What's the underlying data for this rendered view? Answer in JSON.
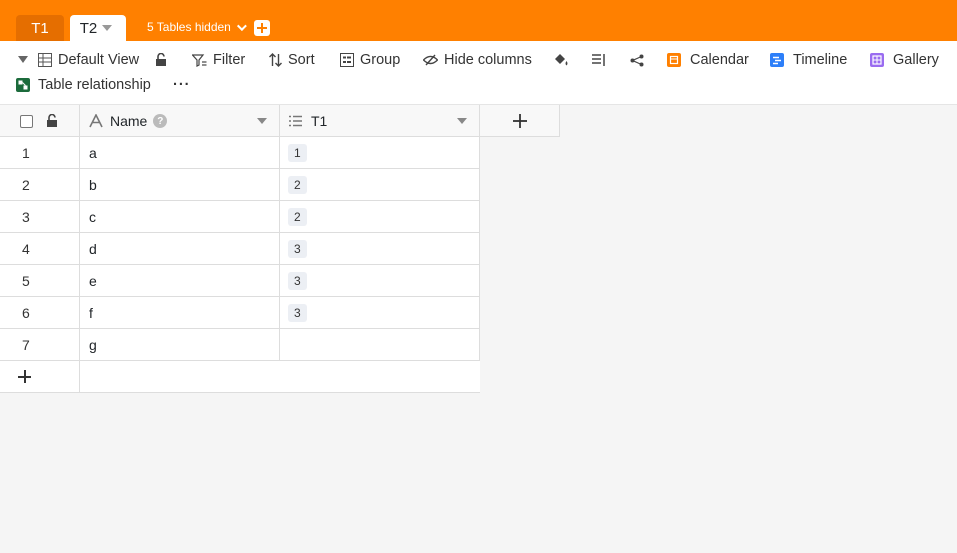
{
  "tabs": [
    {
      "label": "T1",
      "active": false
    },
    {
      "label": "T2",
      "active": true
    }
  ],
  "hidden_tables": "5 Tables hidden",
  "toolbar": {
    "view": "Default View",
    "filter": "Filter",
    "sort": "Sort",
    "group": "Group",
    "hide_columns": "Hide columns",
    "calendar": "Calendar",
    "timeline": "Timeline",
    "gallery": "Gallery",
    "table_relationship": "Table relationship",
    "more": "···"
  },
  "columns": {
    "name": "Name",
    "t1": "T1"
  },
  "rows": [
    {
      "index": "1",
      "name": "a",
      "t1": "1"
    },
    {
      "index": "2",
      "name": "b",
      "t1": "2"
    },
    {
      "index": "3",
      "name": "c",
      "t1": "2"
    },
    {
      "index": "4",
      "name": "d",
      "t1": "3"
    },
    {
      "index": "5",
      "name": "e",
      "t1": "3"
    },
    {
      "index": "6",
      "name": "f",
      "t1": "3"
    },
    {
      "index": "7",
      "name": "g",
      "t1": ""
    }
  ],
  "colors": {
    "accent": "#ff8000",
    "calendar": "#ff8000",
    "timeline": "#2d7ff9",
    "gallery": "#9a6cf0",
    "relationship": "#1c6b3c"
  }
}
